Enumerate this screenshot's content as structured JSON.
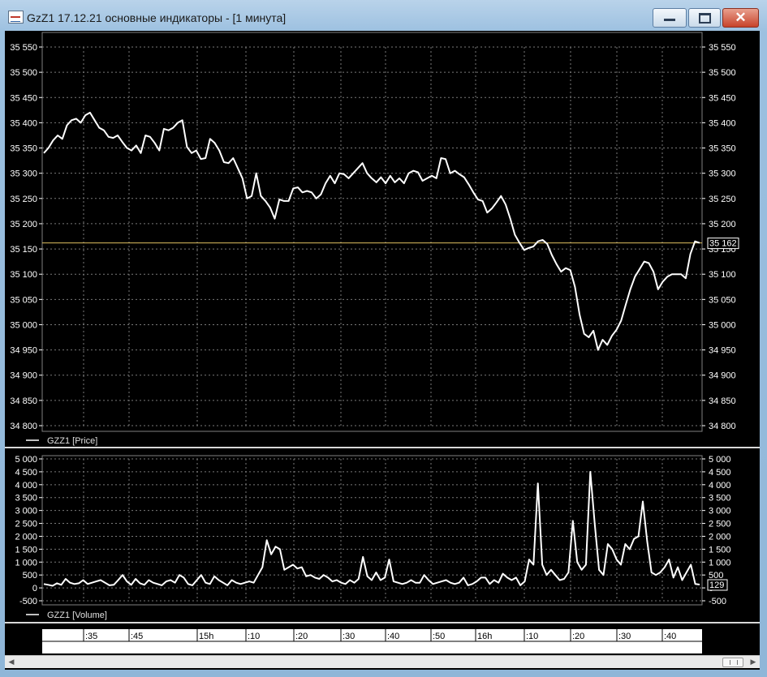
{
  "window": {
    "title": "GzZ1 17.12.21 основные индикаторы - [1 минута]"
  },
  "icons": {
    "app": "chart-app-icon",
    "minimize": "minimize-icon",
    "maximize": "maximize-icon",
    "close": "close-icon"
  },
  "colors": {
    "background": "#000000",
    "line": "#ffffff",
    "grid": "#7a7a7a",
    "current_price": "#e0c060"
  },
  "chart_data": [
    {
      "type": "line",
      "legend": "GZZ1 [Price]",
      "ylim": [
        34800,
        35550
      ],
      "yticks": [
        34800,
        34850,
        34900,
        34950,
        35000,
        35050,
        35100,
        35150,
        35200,
        35250,
        35300,
        35350,
        35400,
        35450,
        35500,
        35550
      ],
      "ytick_labels": [
        "34 800",
        "34 850",
        "34 900",
        "34 950",
        "35 000",
        "35 050",
        "35 100",
        "35 150",
        "35 200",
        "35 250",
        "35 300",
        "35 350",
        "35 400",
        "35 450",
        "35 500",
        "35 550"
      ],
      "current_value": 35162,
      "current_label": "35 162",
      "grid": true,
      "values": [
        35340,
        35350,
        35365,
        35375,
        35368,
        35395,
        35405,
        35408,
        35400,
        35415,
        35420,
        35405,
        35390,
        35385,
        35372,
        35370,
        35375,
        35362,
        35350,
        35345,
        35355,
        35340,
        35375,
        35372,
        35360,
        35345,
        35388,
        35385,
        35390,
        35400,
        35405,
        35352,
        35340,
        35345,
        35328,
        35330,
        35368,
        35360,
        35345,
        35322,
        35320,
        35330,
        35310,
        35290,
        35250,
        35255,
        35300,
        35255,
        35245,
        35232,
        35210,
        35248,
        35245,
        35245,
        35270,
        35272,
        35262,
        35265,
        35262,
        35250,
        35258,
        35280,
        35295,
        35280,
        35300,
        35298,
        35290,
        35300,
        35310,
        35320,
        35300,
        35290,
        35282,
        35292,
        35280,
        35295,
        35282,
        35290,
        35280,
        35300,
        35305,
        35302,
        35285,
        35290,
        35295,
        35290,
        35330,
        35328,
        35300,
        35305,
        35298,
        35292,
        35278,
        35262,
        35248,
        35245,
        35222,
        35230,
        35242,
        35255,
        35238,
        35210,
        35178,
        35162,
        35148,
        35152,
        35155,
        35165,
        35168,
        35160,
        35138,
        35120,
        35105,
        35112,
        35108,
        35075,
        35020,
        34982,
        34975,
        34988,
        34950,
        34970,
        34960,
        34978,
        34990,
        35008,
        35040,
        35070,
        35095,
        35110,
        35125,
        35122,
        35105,
        35070,
        35085,
        35095,
        35100,
        35100,
        35100,
        35092,
        35140,
        35165,
        35162
      ]
    },
    {
      "type": "line",
      "legend": "GZZ1 [Volume]",
      "ylim": [
        -500,
        5000
      ],
      "yticks": [
        -500,
        0,
        500,
        1000,
        1500,
        2000,
        2500,
        3000,
        3500,
        4000,
        4500,
        5000
      ],
      "ytick_labels": [
        "-500",
        "0",
        "500",
        "1 000",
        "1 500",
        "2 000",
        "2 500",
        "3 000",
        "3 500",
        "4 000",
        "4 500",
        "5 000"
      ],
      "current_value": 129,
      "current_label": "129",
      "grid": true,
      "values": [
        150,
        120,
        80,
        180,
        120,
        350,
        200,
        150,
        180,
        300,
        150,
        200,
        250,
        300,
        200,
        100,
        120,
        300,
        500,
        250,
        120,
        350,
        180,
        120,
        300,
        200,
        150,
        100,
        250,
        300,
        200,
        500,
        400,
        150,
        100,
        300,
        500,
        200,
        150,
        450,
        300,
        200,
        100,
        300,
        200,
        150,
        200,
        250,
        200,
        500,
        800,
        1850,
        1300,
        1600,
        1500,
        700,
        800,
        900,
        750,
        800,
        450,
        500,
        400,
        350,
        500,
        400,
        250,
        300,
        200,
        150,
        300,
        200,
        350,
        1200,
        450,
        300,
        600,
        300,
        400,
        1100,
        250,
        200,
        150,
        200,
        300,
        200,
        200,
        500,
        300,
        150,
        200,
        250,
        300,
        200,
        150,
        200,
        400,
        100,
        150,
        250,
        400,
        400,
        150,
        300,
        200,
        550,
        400,
        300,
        400,
        100,
        250,
        1100,
        900,
        4050,
        900,
        500,
        700,
        500,
        300,
        350,
        600,
        2600,
        1000,
        700,
        900,
        4500,
        2500,
        700,
        500,
        1700,
        1500,
        1100,
        900,
        1700,
        1500,
        1900,
        2000,
        3350,
        1800,
        600,
        500,
        600,
        800,
        1100,
        400,
        800,
        300,
        600,
        900,
        150,
        129
      ],
      "x_tick_labels": [
        ":35",
        ":45",
        "15h",
        ":10",
        ":20",
        ":30",
        ":40",
        ":50",
        "16h",
        ":10",
        ":20",
        ":30",
        ":40"
      ]
    }
  ]
}
